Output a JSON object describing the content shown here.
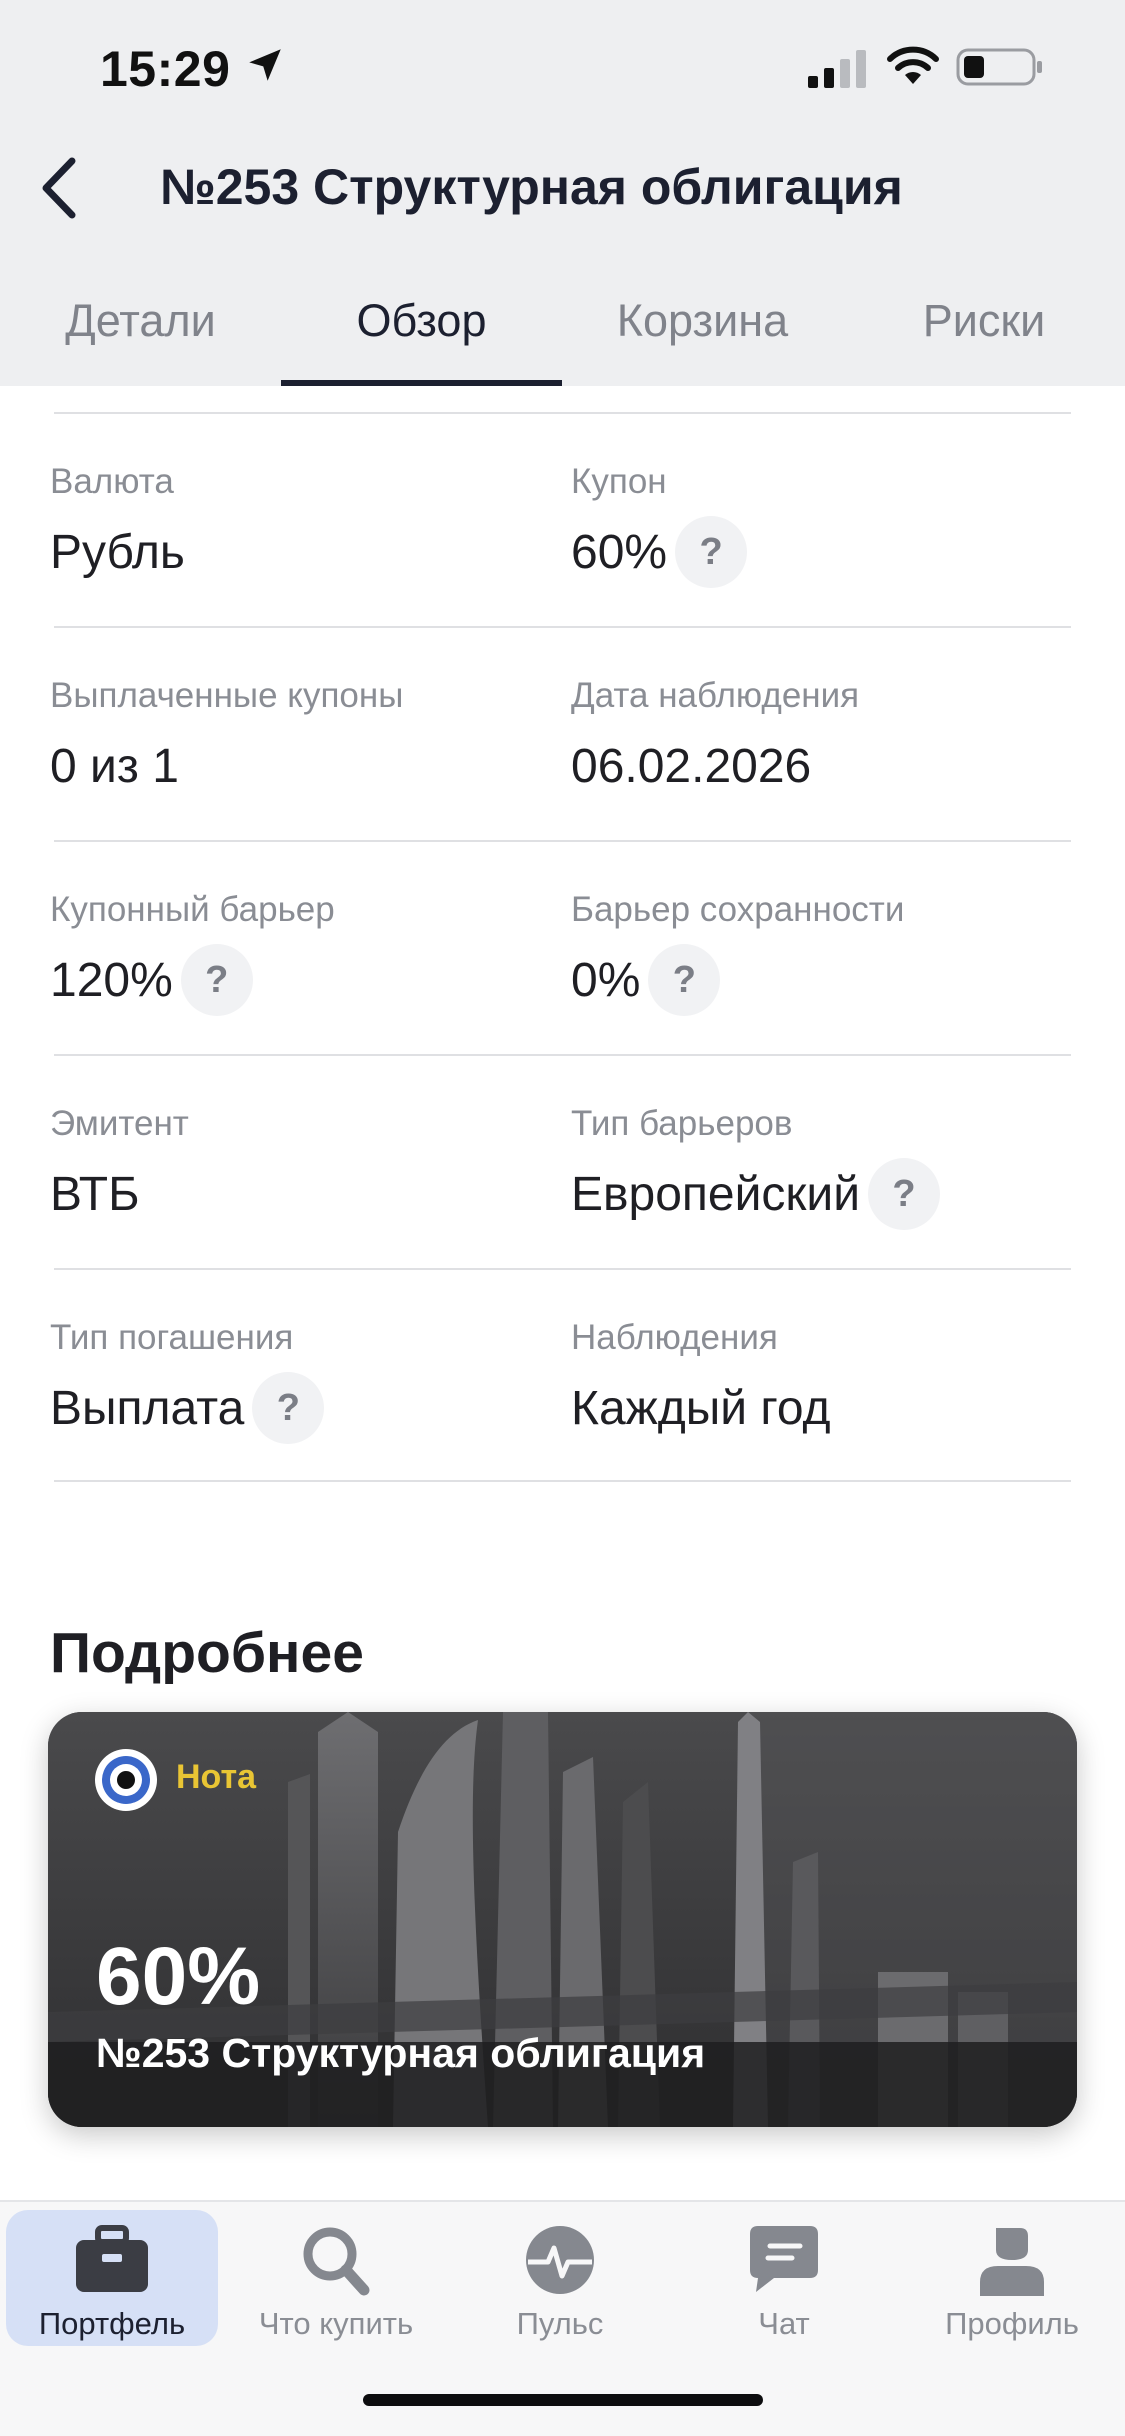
{
  "status": {
    "time": "15:29"
  },
  "header": {
    "title": "№253 Структурная облигация"
  },
  "tabs": [
    {
      "label": "Детали"
    },
    {
      "label": "Обзор"
    },
    {
      "label": "Корзина"
    },
    {
      "label": "Риски"
    }
  ],
  "active_tab": "Обзор",
  "info": {
    "rows": [
      {
        "left": {
          "label": "Валюта",
          "value": "Рубль"
        },
        "right": {
          "label": "Купон",
          "value": "60%"
        }
      },
      {
        "left": {
          "label": "Выплаченные купоны",
          "value": "0 из 1"
        },
        "right": {
          "label": "Дата наблюдения",
          "value": "06.02.2026"
        }
      },
      {
        "left": {
          "label": "Купонный барьер",
          "value": "120%"
        },
        "right": {
          "label": "Барьер сохранности",
          "value": "0%"
        }
      },
      {
        "left": {
          "label": "Эмитент",
          "value": "ВТБ"
        },
        "right": {
          "label": "Тип барьеров",
          "value": "Европейский"
        }
      },
      {
        "left": {
          "label": "Тип погашения",
          "value": "Выплата"
        },
        "right": {
          "label": "Наблюдения",
          "value": "Каждый год"
        }
      }
    ],
    "help_glyph": "?"
  },
  "more": {
    "title": "Подробнее",
    "card": {
      "tag": "Нота",
      "value": "60%",
      "name": "№253 Структурная облигация"
    }
  },
  "bottom_nav": [
    {
      "label": "Портфель",
      "icon": "briefcase-icon"
    },
    {
      "label": "Что купить",
      "icon": "search-icon"
    },
    {
      "label": "Пульс",
      "icon": "pulse-icon"
    },
    {
      "label": "Чат",
      "icon": "chat-icon"
    },
    {
      "label": "Профиль",
      "icon": "profile-icon"
    }
  ],
  "active_nav": "Портфель",
  "colors": {
    "accent_dark": "#1c2030",
    "tag_yellow": "#e9c534",
    "active_nav_bg": "#d6e0f6",
    "header_bg": "#eeeff1"
  }
}
